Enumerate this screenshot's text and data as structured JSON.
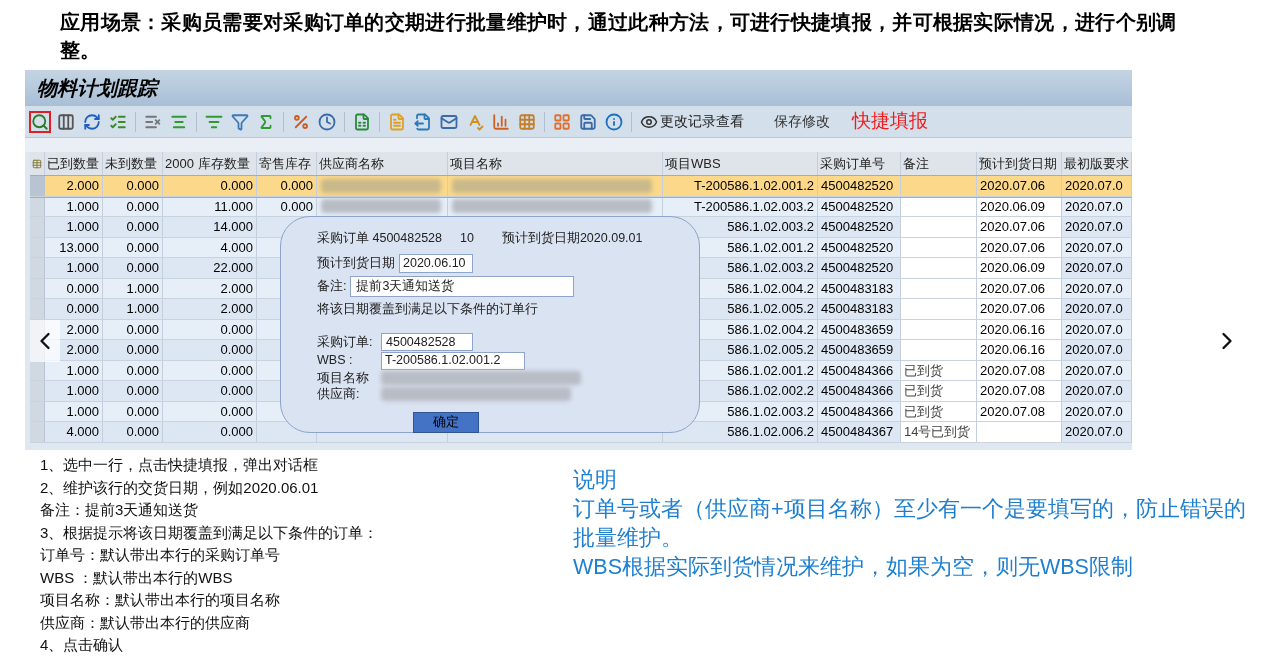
{
  "heading": "应用场景：采购员需要对采购订单的交期进行批量维护时，通过此种方法，可进行快捷填报，并可根据实际情况，进行个别调整。",
  "sap": {
    "title": "物料计划跟踪",
    "toolbar": {
      "change_log": "更改记录查看",
      "save": "保存修改",
      "quick_fill": "快捷填报"
    },
    "columns": [
      "已到数量",
      "未到数量",
      "2000 库存数量",
      "寄售库存",
      "供应商名称",
      "项目名称",
      "项目WBS",
      "采购订单号",
      "备注",
      "预计到货日期",
      "最初版要求"
    ],
    "rows": [
      {
        "selected": true,
        "arrived": "2.000",
        "pending": "0.000",
        "stock": "0.000",
        "consign": "0.000",
        "wbs": "T-200586.1.02.001.2",
        "po": "4500482520",
        "eta": "2020.07.06",
        "initial": "2020.07.0"
      },
      {
        "selected": false,
        "arrived": "1.000",
        "pending": "0.000",
        "stock": "11.000",
        "consign": "0.000",
        "wbs": "T-200586.1.02.003.2",
        "po": "4500482520",
        "eta": "2020.06.09",
        "initial": "2020.07.0"
      },
      {
        "selected": false,
        "arrived": "1.000",
        "pending": "0.000",
        "stock": "14.000",
        "wbs": "586.1.02.003.2",
        "po": "4500482520",
        "eta": "2020.07.06",
        "initial": "2020.07.0"
      },
      {
        "selected": false,
        "arrived": "13.000",
        "pending": "0.000",
        "stock": "4.000",
        "wbs": "586.1.02.001.2",
        "po": "4500482520",
        "eta": "2020.07.06",
        "initial": "2020.07.0"
      },
      {
        "selected": false,
        "arrived": "1.000",
        "pending": "0.000",
        "stock": "22.000",
        "wbs": "586.1.02.003.2",
        "po": "4500482520",
        "eta": "2020.06.09",
        "initial": "2020.07.0"
      },
      {
        "selected": false,
        "arrived": "0.000",
        "pending": "1.000",
        "stock": "2.000",
        "wbs": "586.1.02.004.2",
        "po": "4500483183",
        "eta": "2020.07.06",
        "initial": "2020.07.0"
      },
      {
        "selected": false,
        "arrived": "0.000",
        "pending": "1.000",
        "stock": "2.000",
        "wbs": "586.1.02.005.2",
        "po": "4500483183",
        "eta": "2020.07.06",
        "initial": "2020.07.0"
      },
      {
        "selected": false,
        "arrived": "2.000",
        "pending": "0.000",
        "stock": "0.000",
        "wbs": "586.1.02.004.2",
        "po": "4500483659",
        "eta": "2020.06.16",
        "initial": "2020.07.0"
      },
      {
        "selected": false,
        "arrived": "2.000",
        "pending": "0.000",
        "stock": "0.000",
        "wbs": "586.1.02.005.2",
        "po": "4500483659",
        "eta": "2020.06.16",
        "initial": "2020.07.0"
      },
      {
        "selected": false,
        "arrived": "1.000",
        "pending": "0.000",
        "stock": "0.000",
        "wbs": "586.1.02.001.2",
        "po": "4500484366",
        "note": "已到货",
        "eta": "2020.07.08",
        "initial": "2020.07.0"
      },
      {
        "selected": false,
        "arrived": "1.000",
        "pending": "0.000",
        "stock": "0.000",
        "wbs": "586.1.02.002.2",
        "po": "4500484366",
        "note": "已到货",
        "eta": "2020.07.08",
        "initial": "2020.07.0"
      },
      {
        "selected": false,
        "arrived": "1.000",
        "pending": "0.000",
        "stock": "0.000",
        "wbs": "586.1.02.003.2",
        "po": "4500484366",
        "note": "已到货",
        "eta": "2020.07.08",
        "initial": "2020.07.0"
      },
      {
        "selected": false,
        "arrived": "4.000",
        "pending": "0.000",
        "stock": "0.000",
        "wbs": "586.1.02.006.2",
        "po": "4500484367",
        "note": "14号已到货",
        "initial": "2020.07.0"
      }
    ],
    "dialog": {
      "order_label": "采购订单 4500482528",
      "order_item": "10",
      "order_eta": "预计到货日期2020.09.01",
      "date_label": "预计到货日期",
      "date_value": "2020.06.10",
      "note_label": "备注:",
      "note_value": "提前3天通知送货",
      "instruction": "将该日期覆盖到满足以下条件的订单行",
      "po_label": "采购订单:",
      "po_value": "4500482528",
      "wbs_label": "WBS :",
      "wbs_value": "T-200586.1.02.001.2",
      "project_label": "项目名称",
      "supplier_label": "供应商:",
      "confirm": "确定"
    }
  },
  "steps": [
    "1、选中一行，点击快捷填报，弹出对话框",
    "2、维护该行的交货日期，例如2020.06.01",
    "备注：提前3天通知送货",
    "3、根据提示将该日期覆盖到满足以下条件的订单：",
    "订单号：默认带出本行的采购订单号",
    "WBS ：默认带出本行的WBS",
    "项目名称：默认带出本行的项目名称",
    "供应商：默认带出本行的供应商",
    "4、点击确认"
  ],
  "note": {
    "title": "说明",
    "lines": [
      "订单号或者（供应商+项目名称）至少有一个是要填写的，防止错误的批量维护。",
      "WBS根据实际到货情况来维护，如果为空，则无WBS限制"
    ]
  }
}
